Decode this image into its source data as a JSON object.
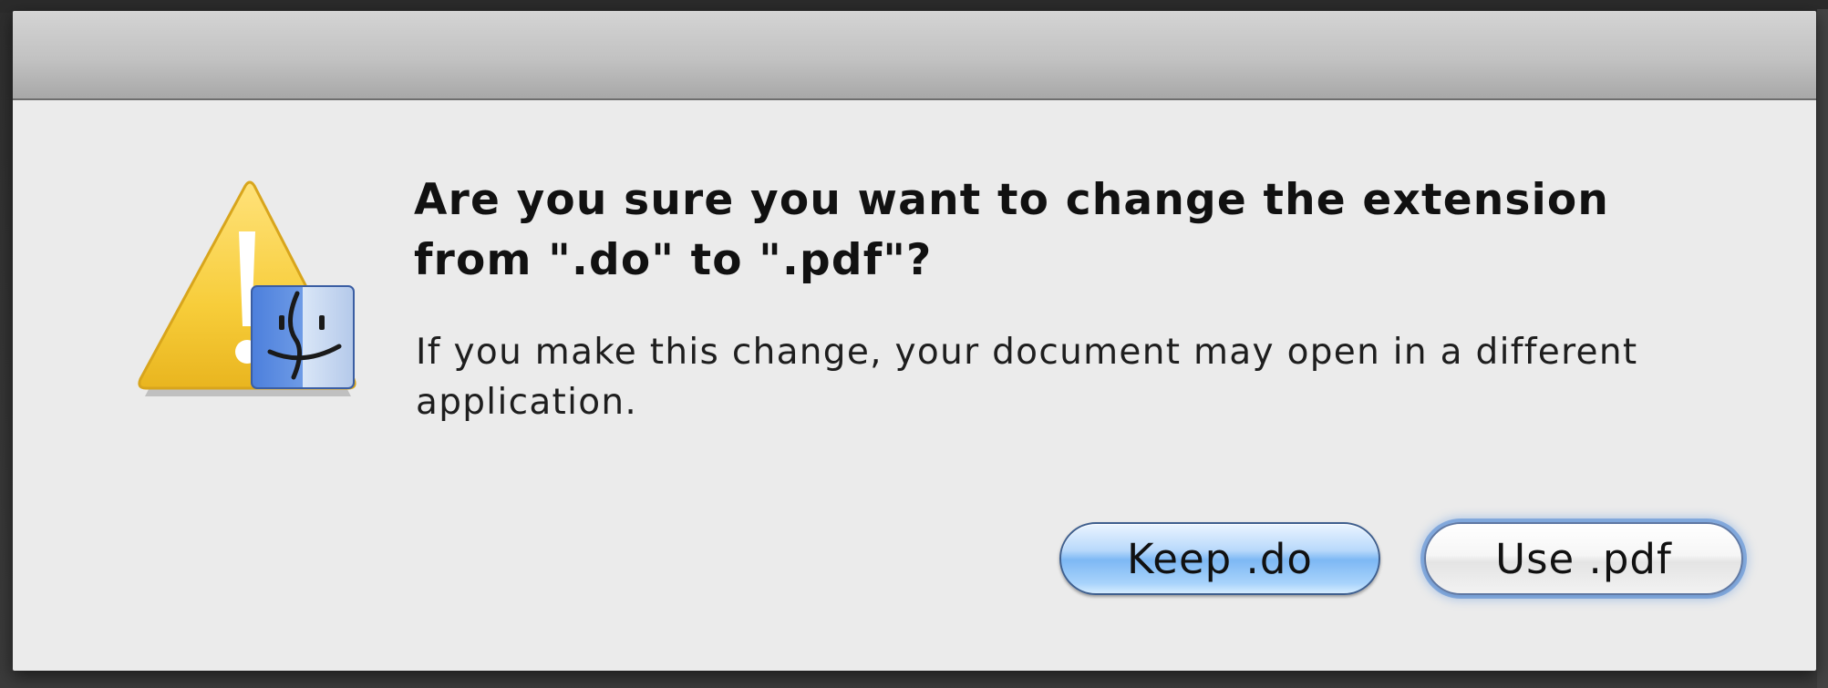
{
  "dialog": {
    "message": "Are you sure you want to change the extension from \".do\" to \".pdf\"?",
    "informative_text": "If you make this change, your document may open in a different application.",
    "icon": "caution-finder-icon"
  },
  "buttons": {
    "keep_label": "Keep .do",
    "use_label": "Use .pdf"
  },
  "colors": {
    "sheet_background": "#ebebeb",
    "default_button_blue": "#7db8f4",
    "warning_yellow": "#f7cd3a"
  }
}
